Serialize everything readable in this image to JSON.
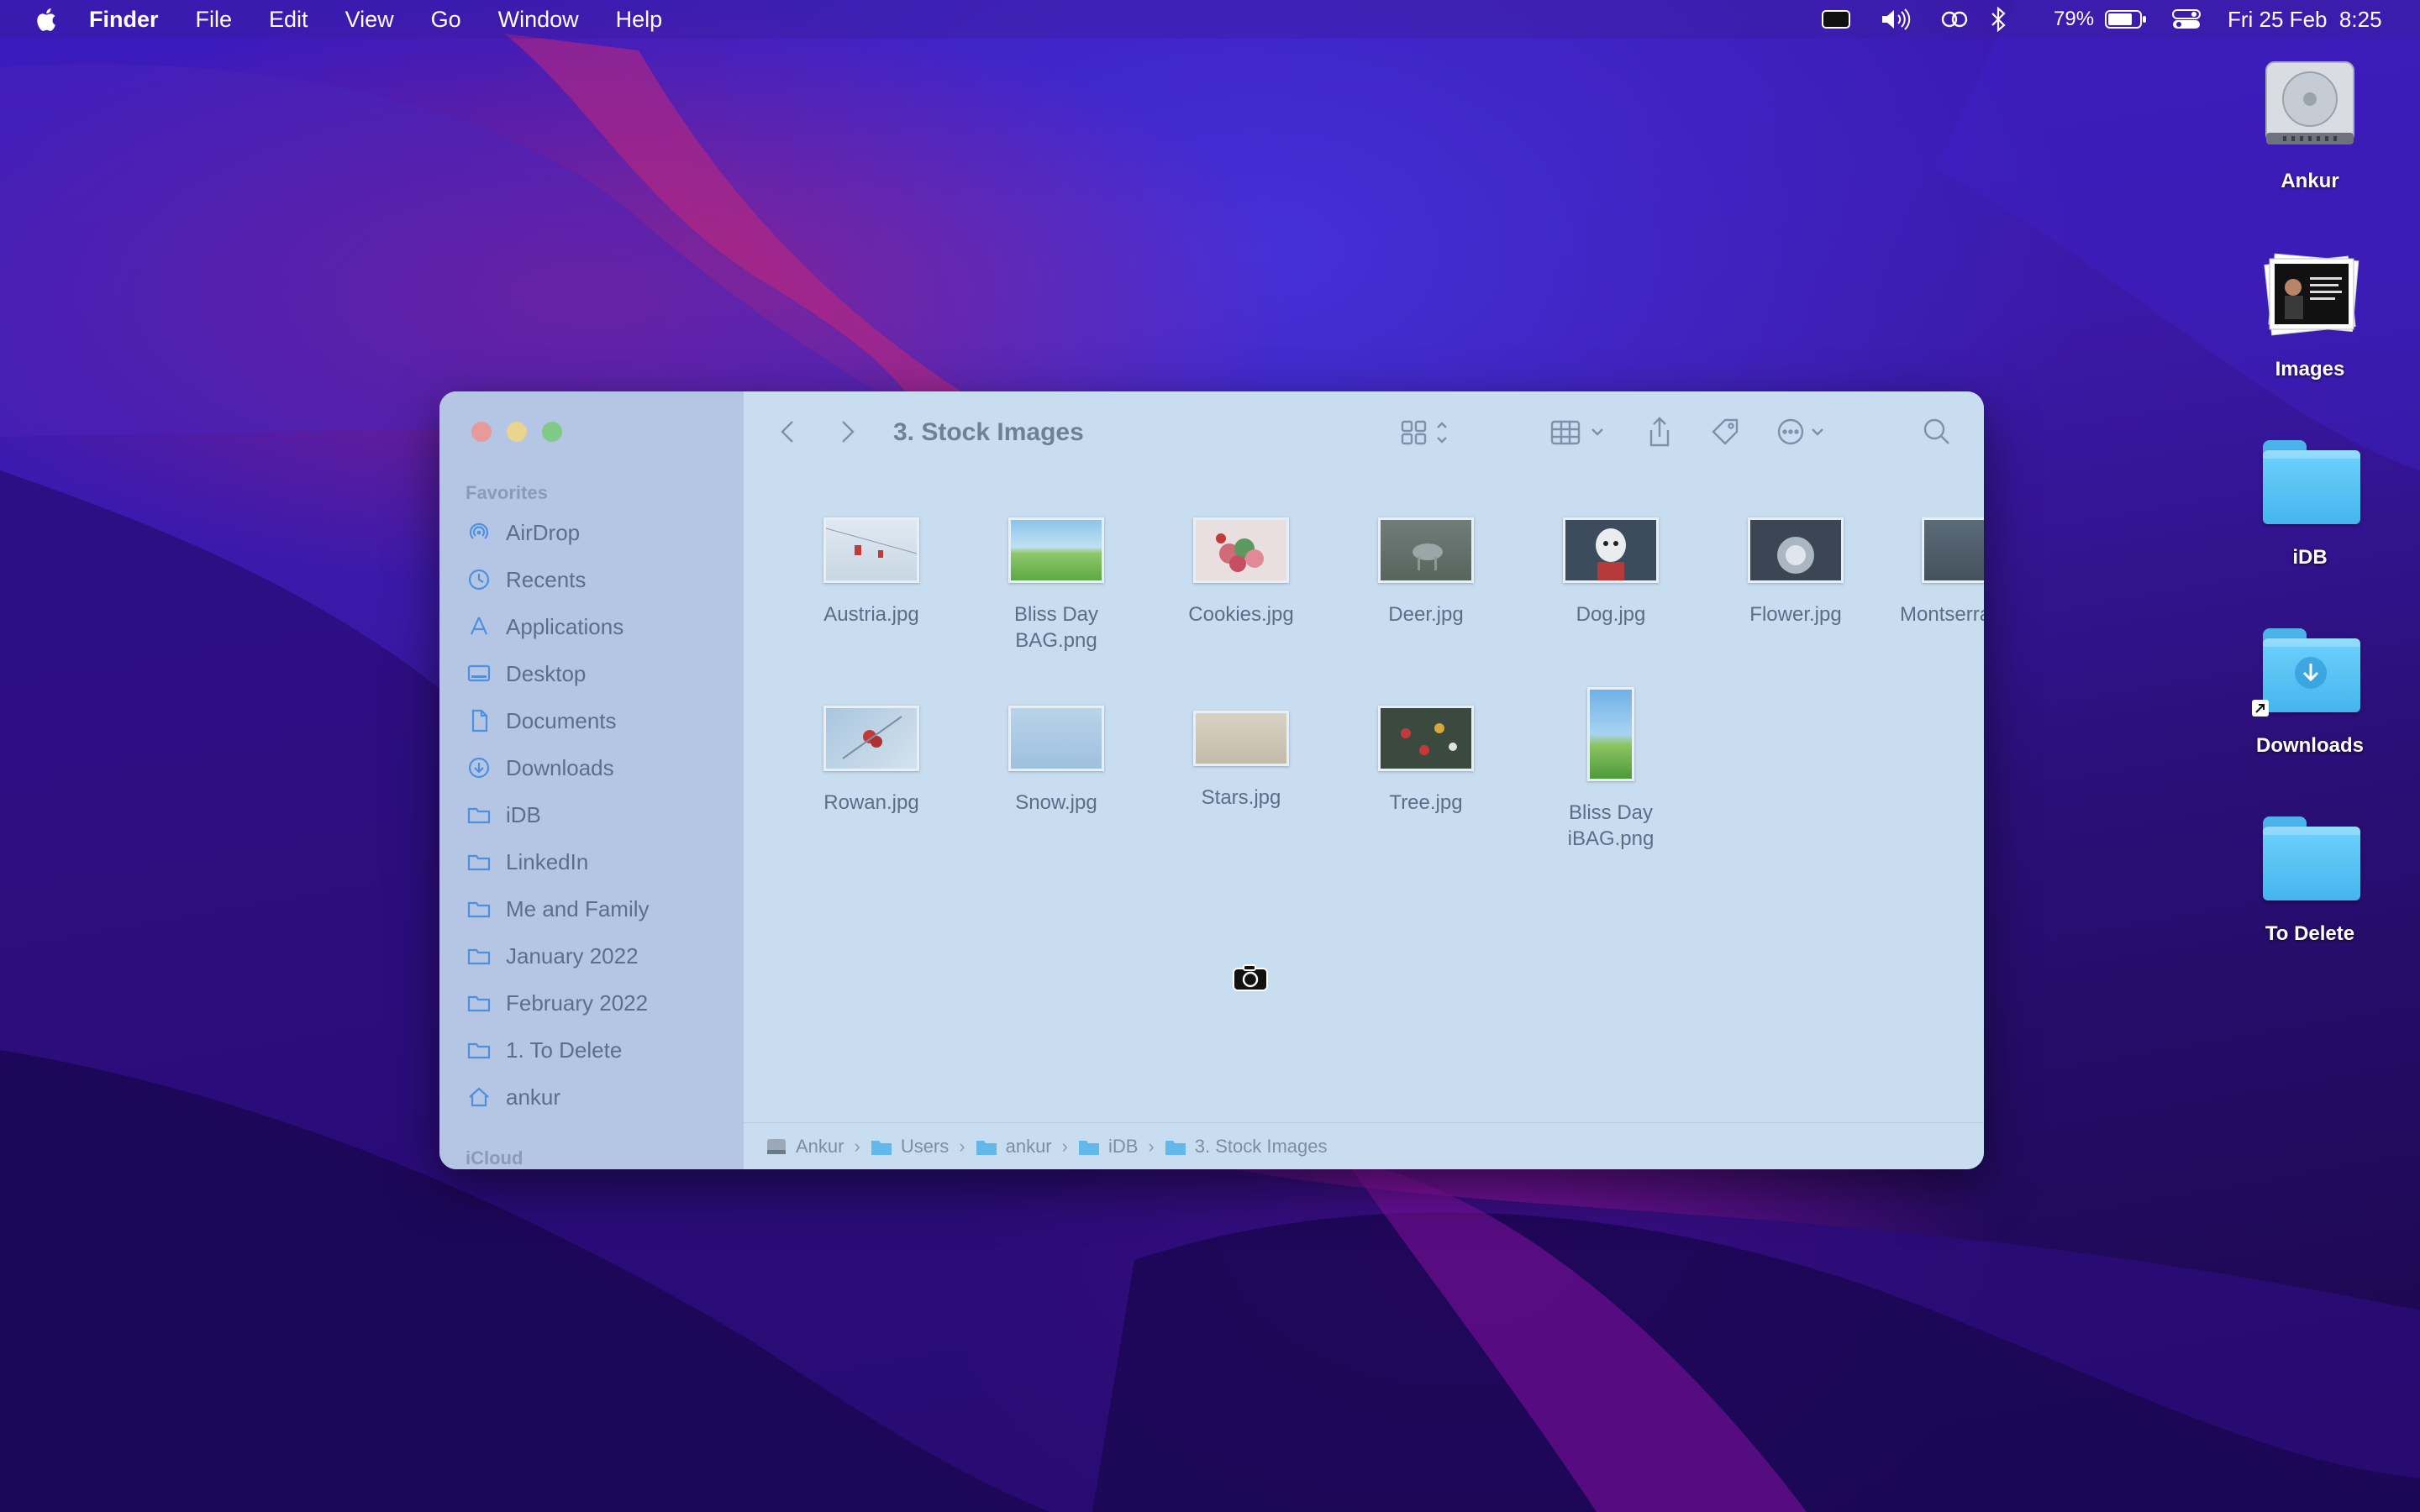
{
  "menubar": {
    "app_name": "Finder",
    "menus": [
      "File",
      "Edit",
      "View",
      "Go",
      "Window",
      "Help"
    ],
    "battery_percent": "79%",
    "datetime": "Fri 25 Feb  8:25"
  },
  "desktop_icons": [
    {
      "label": "Ankur",
      "icon": "hard-drive-icon"
    },
    {
      "label": "Images",
      "icon": "image-stack-icon"
    },
    {
      "label": "iDB",
      "icon": "folder-icon"
    },
    {
      "label": "Downloads",
      "icon": "downloads-folder-icon"
    },
    {
      "label": "To Delete",
      "icon": "folder-icon"
    }
  ],
  "window": {
    "title": "3. Stock Images",
    "sidebar": {
      "favorites_header": "Favorites",
      "icloud_header": "iCloud",
      "items": [
        {
          "label": "AirDrop",
          "icon": "airdrop-icon"
        },
        {
          "label": "Recents",
          "icon": "clock-icon"
        },
        {
          "label": "Applications",
          "icon": "applications-icon"
        },
        {
          "label": "Desktop",
          "icon": "desktop-icon"
        },
        {
          "label": "Documents",
          "icon": "document-icon"
        },
        {
          "label": "Downloads",
          "icon": "download-icon"
        },
        {
          "label": "iDB",
          "icon": "folder-icon"
        },
        {
          "label": "LinkedIn",
          "icon": "folder-icon"
        },
        {
          "label": "Me and Family",
          "icon": "folder-icon"
        },
        {
          "label": "January 2022",
          "icon": "folder-icon"
        },
        {
          "label": "February 2022",
          "icon": "folder-icon"
        },
        {
          "label": "1. To Delete",
          "icon": "folder-icon"
        },
        {
          "label": "ankur",
          "icon": "home-icon"
        }
      ]
    },
    "files": [
      {
        "name": "Austria.jpg"
      },
      {
        "name": "Bliss Day BAG.png"
      },
      {
        "name": "Cookies.jpg"
      },
      {
        "name": "Deer.jpg"
      },
      {
        "name": "Dog.jpg"
      },
      {
        "name": "Flower.jpg"
      },
      {
        "name": "Montserra"
      },
      {
        "name": "Rowan.jpg"
      },
      {
        "name": "Snow.jpg"
      },
      {
        "name": "Stars.jpg"
      },
      {
        "name": "Tree.jpg"
      },
      {
        "name": "Bliss Day iBAG.png"
      }
    ],
    "path": [
      "Ankur",
      "Users",
      "ankur",
      "iDB",
      "3. Stock Images"
    ]
  }
}
